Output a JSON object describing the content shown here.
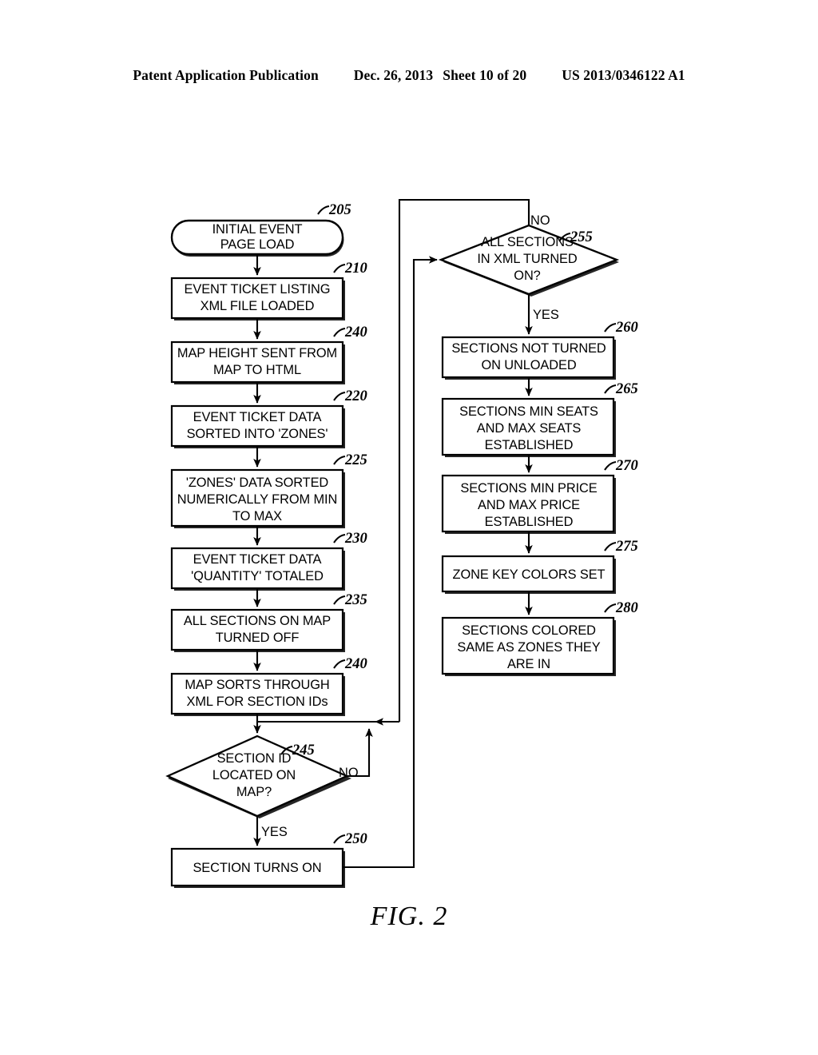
{
  "header": {
    "publication": "Patent Application Publication",
    "date": "Dec. 26, 2013",
    "sheet": "Sheet 10 of 20",
    "patent_number": "US 2013/0346122 A1"
  },
  "figure": {
    "caption": "FIG. 2",
    "type": "flowchart",
    "nodes": [
      {
        "ref": "205",
        "shape": "terminator",
        "lines": [
          "INITIAL EVENT",
          "PAGE LOAD"
        ]
      },
      {
        "ref": "210",
        "shape": "process",
        "lines": [
          "EVENT TICKET LISTING",
          "XML FILE LOADED"
        ]
      },
      {
        "ref": "240",
        "shape": "process",
        "lines": [
          "MAP HEIGHT SENT FROM",
          "MAP TO HTML"
        ]
      },
      {
        "ref": "220",
        "shape": "process",
        "lines": [
          "EVENT TICKET DATA",
          "SORTED INTO 'ZONES'"
        ]
      },
      {
        "ref": "225",
        "shape": "process",
        "lines": [
          "'ZONES' DATA SORTED",
          "NUMERICALLY FROM MIN",
          "TO MAX"
        ]
      },
      {
        "ref": "230",
        "shape": "process",
        "lines": [
          "EVENT TICKET DATA",
          "'QUANTITY' TOTALED"
        ]
      },
      {
        "ref": "235",
        "shape": "process",
        "lines": [
          "ALL SECTIONS ON MAP",
          "TURNED OFF"
        ]
      },
      {
        "ref": "240b",
        "shape": "process",
        "lines": [
          "MAP SORTS THROUGH",
          "XML FOR SECTION IDs"
        ]
      },
      {
        "ref": "245",
        "shape": "decision",
        "lines": [
          "SECTION ID",
          "LOCATED ON",
          "MAP?"
        ]
      },
      {
        "ref": "250",
        "shape": "process",
        "lines": [
          "SECTION TURNS ON"
        ]
      },
      {
        "ref": "255",
        "shape": "decision",
        "lines": [
          "ALL SECTIONS",
          "IN XML TURNED",
          "ON?"
        ]
      },
      {
        "ref": "260",
        "shape": "process",
        "lines": [
          "SECTIONS NOT TURNED",
          "ON UNLOADED"
        ]
      },
      {
        "ref": "265",
        "shape": "process",
        "lines": [
          "SECTIONS MIN SEATS",
          "AND MAX SEATS",
          "ESTABLISHED"
        ]
      },
      {
        "ref": "270",
        "shape": "process",
        "lines": [
          "SECTIONS MIN PRICE",
          "AND MAX PRICE",
          "ESTABLISHED"
        ]
      },
      {
        "ref": "275",
        "shape": "process",
        "lines": [
          "ZONE KEY COLORS SET"
        ]
      },
      {
        "ref": "280",
        "shape": "process",
        "lines": [
          "SECTIONS COLORED",
          "SAME AS ZONES THEY",
          "ARE IN"
        ]
      }
    ],
    "ref_labels": {
      "n205": "205",
      "n210": "210",
      "n240a": "240",
      "n220": "220",
      "n225": "225",
      "n230": "230",
      "n235": "235",
      "n240b": "240",
      "n245": "245",
      "n250": "250",
      "n255": "255",
      "n260": "260",
      "n265": "265",
      "n270": "270",
      "n275": "275",
      "n280": "280"
    },
    "branch_labels": {
      "d245_no": "NO",
      "d245_yes": "YES",
      "d255_no": "NO",
      "d255_yes": "YES"
    },
    "node_text": {
      "n205_l1": "INITIAL EVENT",
      "n205_l2": "PAGE LOAD",
      "n210_l1": "EVENT TICKET LISTING",
      "n210_l2": "XML FILE LOADED",
      "n240a_l1": "MAP HEIGHT SENT FROM",
      "n240a_l2": "MAP TO HTML",
      "n220_l1": "EVENT TICKET DATA",
      "n220_l2": "SORTED INTO 'ZONES'",
      "n225_l1": "'ZONES' DATA SORTED",
      "n225_l2": "NUMERICALLY FROM MIN",
      "n225_l3": "TO MAX",
      "n230_l1": "EVENT TICKET DATA",
      "n230_l2": "'QUANTITY' TOTALED",
      "n235_l1": "ALL SECTIONS ON MAP",
      "n235_l2": "TURNED OFF",
      "n240b_l1": "MAP SORTS THROUGH",
      "n240b_l2": "XML FOR SECTION IDs",
      "n245_l1": "SECTION ID",
      "n245_l2": "LOCATED ON",
      "n245_l3": "MAP?",
      "n250_l1": "SECTION TURNS ON",
      "n255_l1": "ALL SECTIONS",
      "n255_l2": "IN XML TURNED",
      "n255_l3": "ON?",
      "n260_l1": "SECTIONS NOT TURNED",
      "n260_l2": "ON UNLOADED",
      "n265_l1": "SECTIONS MIN SEATS",
      "n265_l2": "AND MAX SEATS",
      "n265_l3": "ESTABLISHED",
      "n270_l1": "SECTIONS MIN PRICE",
      "n270_l2": "AND MAX PRICE",
      "n270_l3": "ESTABLISHED",
      "n275_l1": "ZONE KEY COLORS SET",
      "n280_l1": "SECTIONS COLORED",
      "n280_l2": "SAME AS ZONES THEY",
      "n280_l3": "ARE IN"
    }
  },
  "colors": {
    "ink": "#000000",
    "paper": "#ffffff"
  }
}
